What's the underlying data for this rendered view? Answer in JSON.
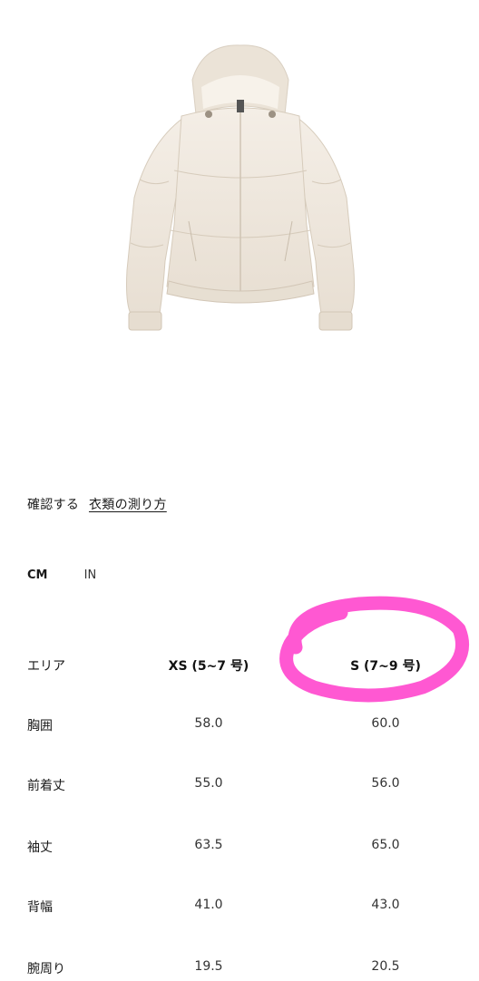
{
  "product": {
    "image_icon": "cream-puffer-jacket-image"
  },
  "measure_info": {
    "prefix": "確認する",
    "link": "衣類の測り方"
  },
  "unit_tabs": [
    {
      "label": "CM",
      "active": true
    },
    {
      "label": "IN",
      "active": false
    }
  ],
  "size_table": {
    "header": [
      "エリア",
      "XS (5~7 号)",
      "S (7~9 号)"
    ],
    "rows": [
      [
        "胸囲",
        "58.0",
        "60.0"
      ],
      [
        "前着丈",
        "55.0",
        "56.0"
      ],
      [
        "袖丈",
        "63.5",
        "65.0"
      ],
      [
        "背幅",
        "41.0",
        "43.0"
      ],
      [
        "腕周り",
        "19.5",
        "20.5"
      ]
    ]
  },
  "colors": {
    "highlight": "#ff4fd0",
    "jacket": "#efe7dc"
  }
}
